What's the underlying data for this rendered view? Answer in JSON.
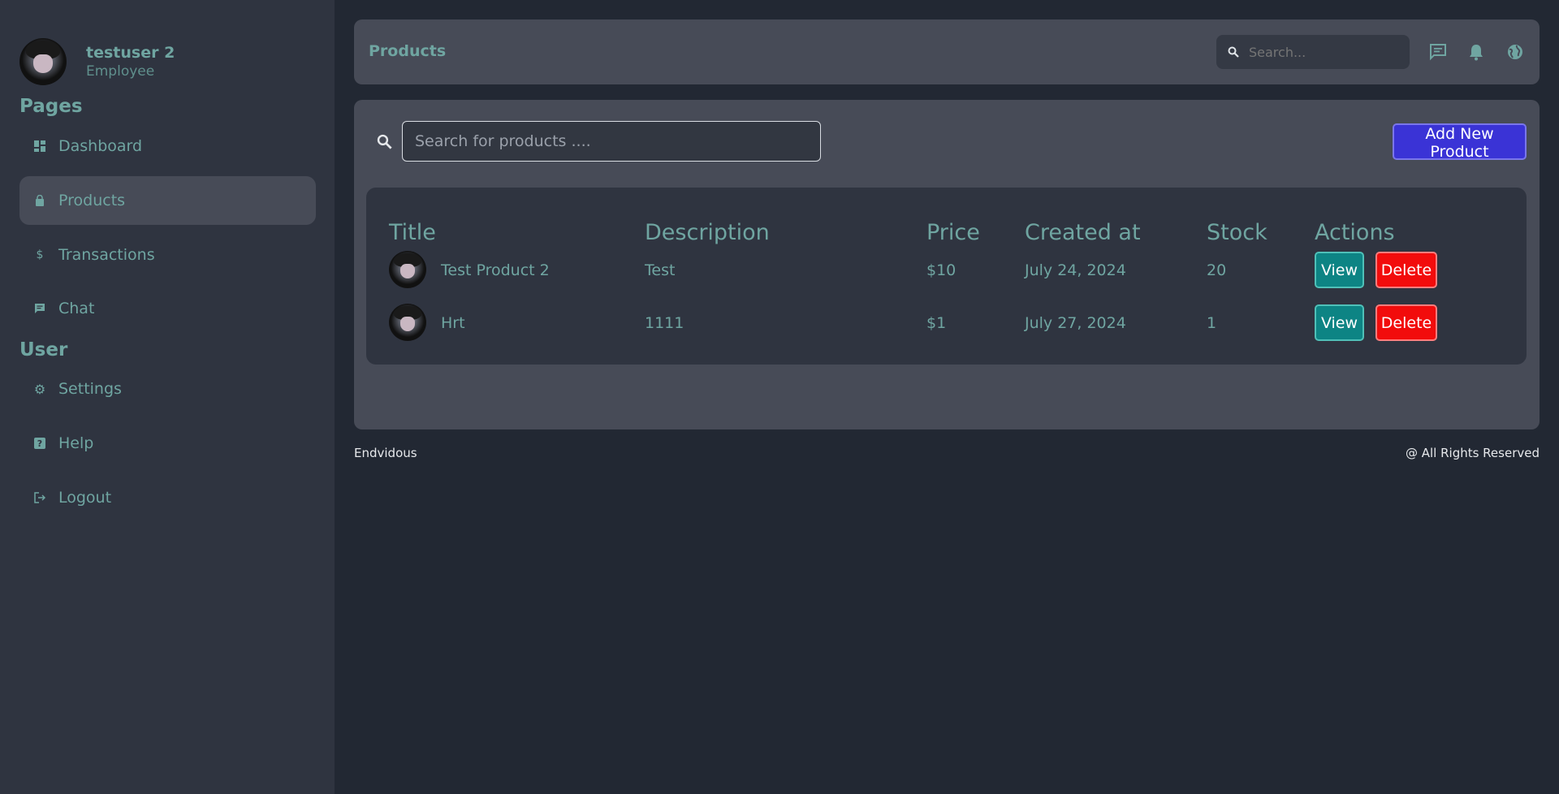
{
  "user": {
    "name": "testuser 2",
    "role": "Employee",
    "avatar_icon": "user-avatar"
  },
  "sidebar": {
    "pages_title": "Pages",
    "user_title": "User",
    "pages": [
      {
        "label": "Dashboard",
        "icon": "dashboard-icon",
        "active": false
      },
      {
        "label": "Products",
        "icon": "bag-icon",
        "active": true
      },
      {
        "label": "Transactions",
        "icon": "dollar-icon",
        "active": false
      },
      {
        "label": "Chat",
        "icon": "chat-icon",
        "active": false
      }
    ],
    "user_items": [
      {
        "label": "Settings",
        "icon": "gear-icon"
      },
      {
        "label": "Help",
        "icon": "help-icon"
      },
      {
        "label": "Logout",
        "icon": "logout-icon"
      }
    ]
  },
  "topbar": {
    "title": "Products",
    "search_placeholder": "Search...",
    "icons": [
      "message-icon",
      "bell-icon",
      "globe-icon"
    ]
  },
  "products": {
    "search_placeholder": "Search for products ....",
    "add_button": "Add New Product",
    "columns": [
      "Title",
      "Description",
      "Price",
      "Created at",
      "Stock",
      "Actions"
    ],
    "rows": [
      {
        "title": "Test Product 2",
        "description": "Test",
        "price": "$10",
        "created_at": "July 24, 2024",
        "stock": "20"
      },
      {
        "title": "Hrt",
        "description": "1111",
        "price": "$1",
        "created_at": "July 27, 2024",
        "stock": "1"
      }
    ],
    "view_label": "View",
    "delete_label": "Delete"
  },
  "footer": {
    "brand": "Endvidous",
    "rights": "@ All Rights Reserved"
  },
  "colors": {
    "background": "#222833",
    "sidebar": "#2f3440",
    "panel": "#474b57",
    "accent_text": "#6fa5a1",
    "add_button": "#3a33d6",
    "view_button": "#0d8484",
    "delete_button": "#f20c0c"
  }
}
